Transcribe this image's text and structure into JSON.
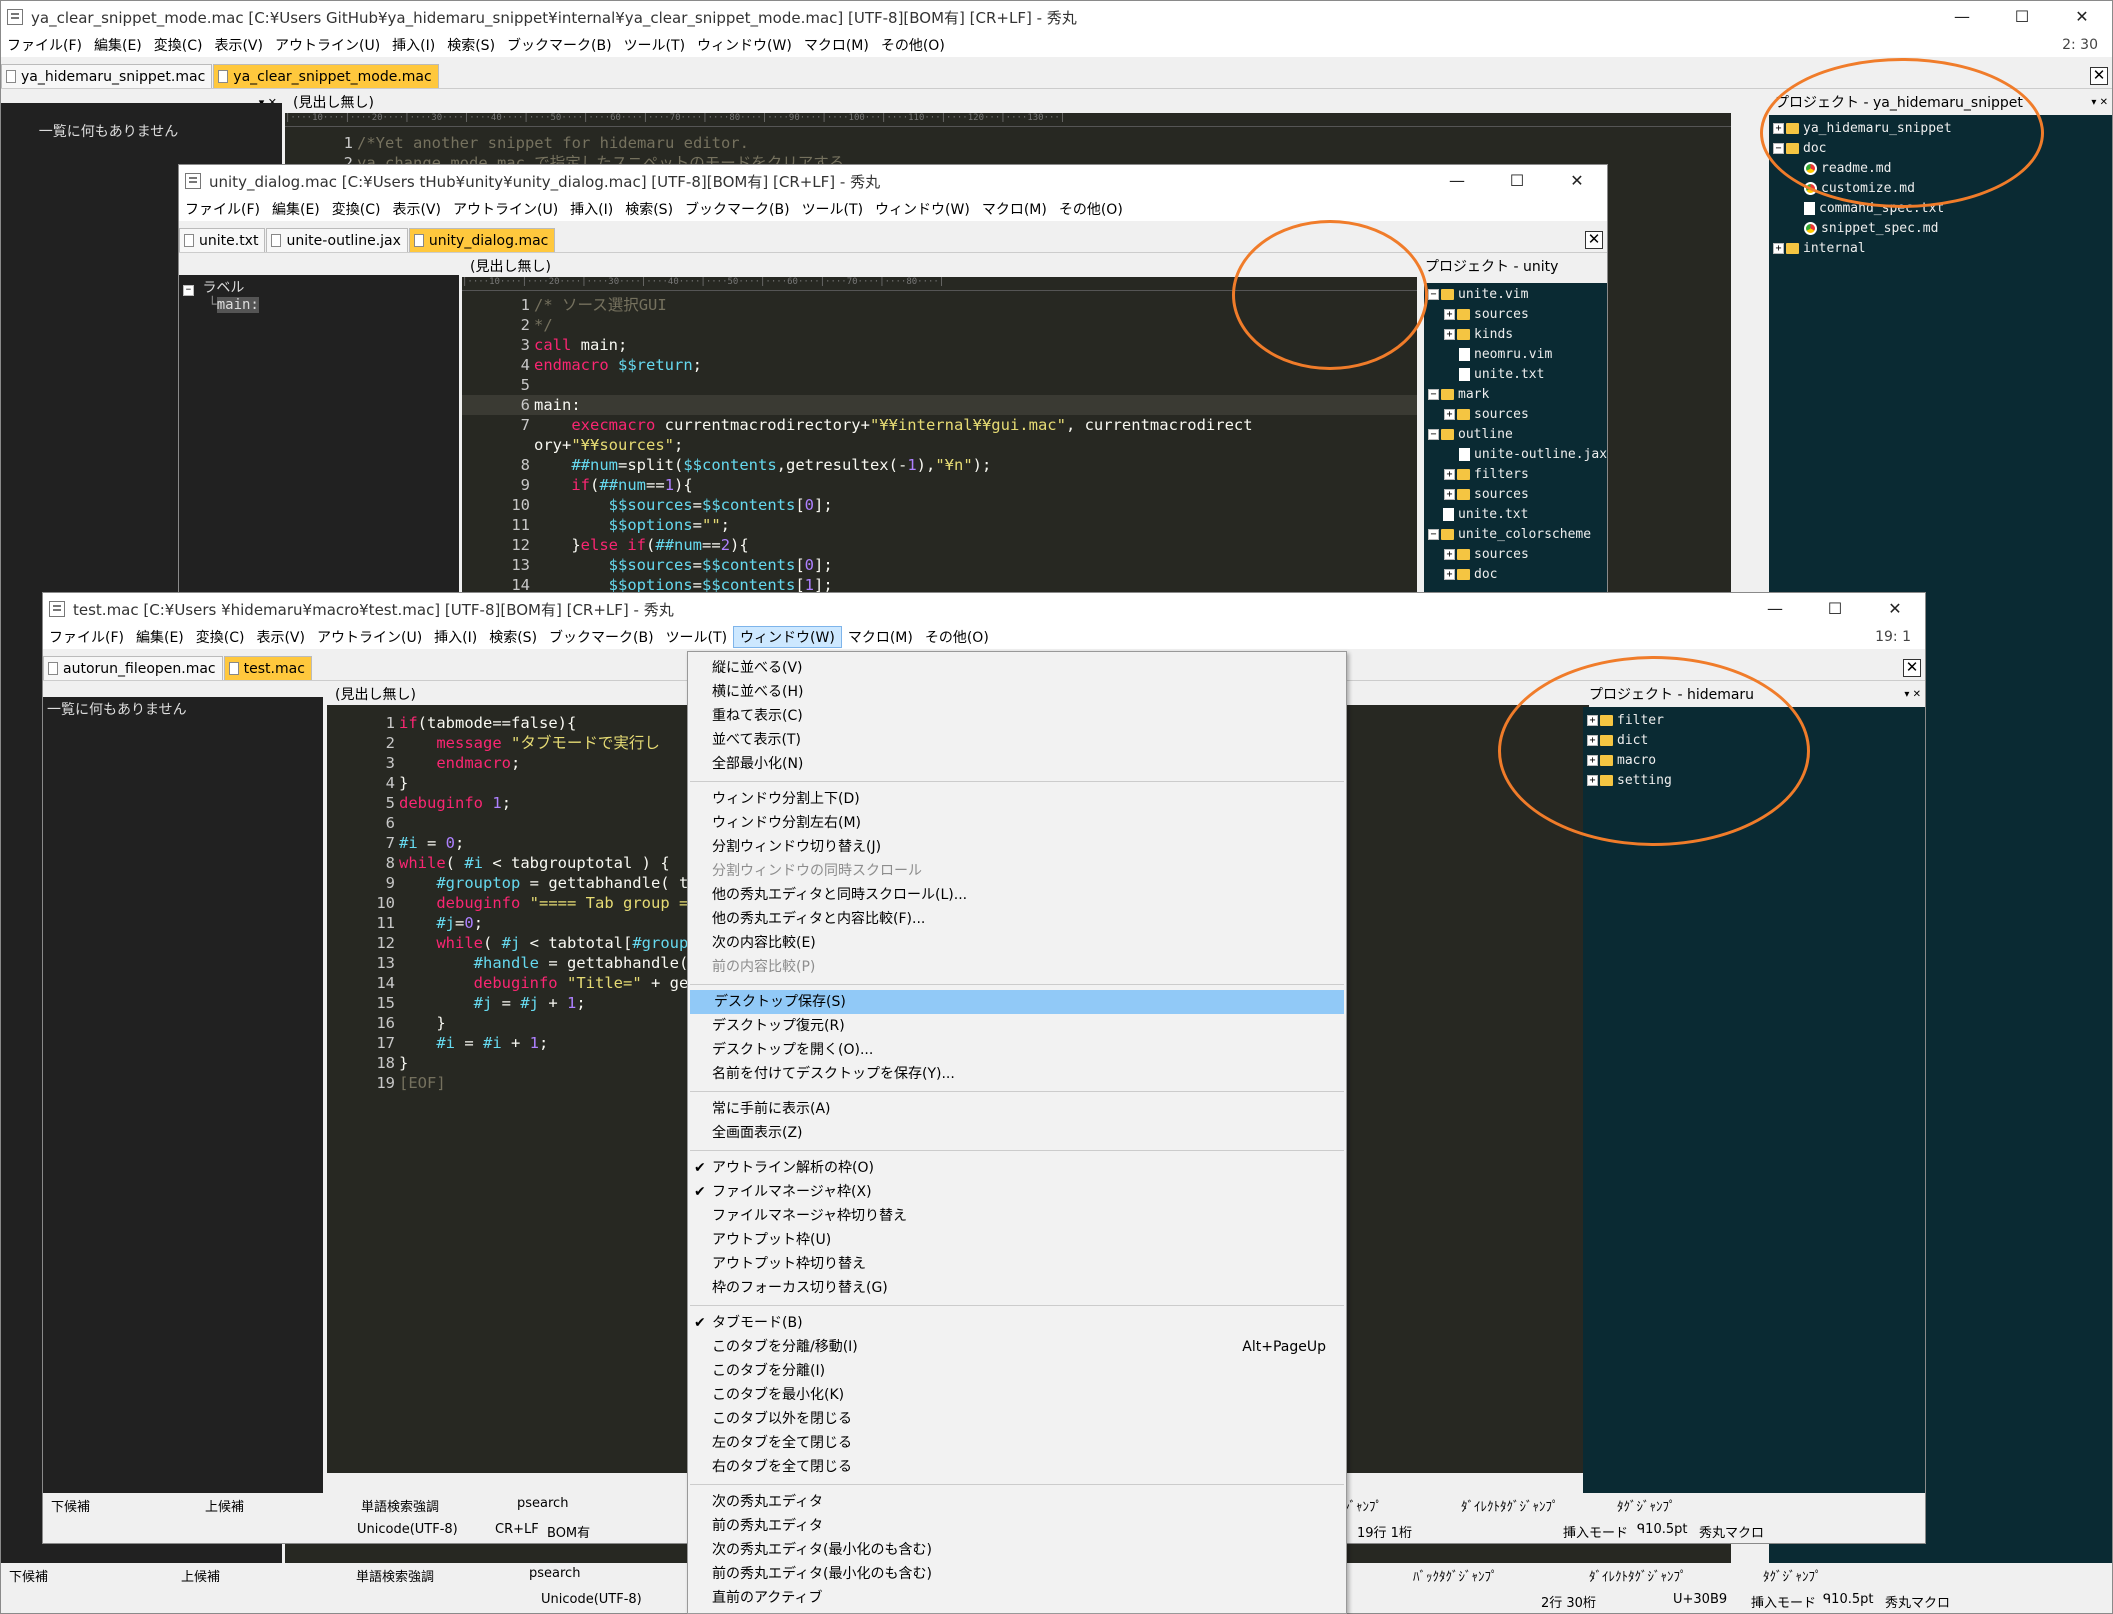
{
  "win1": {
    "title": "ya_clear_snippet_mode.mac [C:¥Users               GitHub¥ya_hidemaru_snippet¥internal¥ya_clear_snippet_mode.mac] [UTF-8][BOM有] [CR+LF] - 秀丸",
    "controls": [
      "—",
      "☐",
      "✕"
    ],
    "menus": [
      "ファイル(F)",
      "編集(E)",
      "変換(C)",
      "表示(V)",
      "アウトライン(U)",
      "挿入(I)",
      "検索(S)",
      "ブックマーク(B)",
      "ツール(T)",
      "ウィンドウ(W)",
      "マクロ(M)",
      "その他(O)"
    ],
    "cursor_pos": "2: 30",
    "tabs": [
      "ya_hidemaru_snippet.mac",
      "ya_clear_snippet_mode.mac"
    ],
    "outline_empty": "一覧に何もありません",
    "heading_none": "(見出し無し)",
    "code": [
      {
        "n": "1",
        "t": "/*Yet another snippet for hidemaru editor."
      },
      {
        "n": "2",
        "t": "ya_change_mode.mac で指定したスニペットのモードをクリアする。"
      }
    ],
    "project_title": "プロジェクト - ya_hidemaru_snippet",
    "project_tree": [
      {
        "label": "ya_hidemaru_snippet",
        "kind": "folder",
        "depth": 0
      },
      {
        "label": "doc",
        "kind": "folder",
        "depth": 0,
        "open": true
      },
      {
        "label": "readme.md",
        "kind": "chrome",
        "depth": 1
      },
      {
        "label": "customize.md",
        "kind": "chrome",
        "depth": 1
      },
      {
        "label": "command_spec.txt",
        "kind": "file",
        "depth": 1
      },
      {
        "label": "snippet_spec.md",
        "kind": "chrome",
        "depth": 1
      },
      {
        "label": "internal",
        "kind": "folder",
        "depth": 0
      }
    ],
    "status_left": [
      "下候補",
      "上候補",
      "単語検索強調",
      "psearch"
    ],
    "status_right": [
      "ﾊﾞｯｸﾀｸﾞｼﾞｬﾝﾌﾟ",
      "ﾀﾞｲﾚｸﾄﾀｸﾞｼﾞｬﾝﾌﾟ",
      "ﾀｸﾞｼﾞｬﾝﾌﾟ"
    ],
    "status2": [
      "Unicode(UTF-8)",
      "2行 30桁",
      "U+30B9",
      "挿入モード",
      "ᑫ10.5pt",
      "秀丸マクロ"
    ]
  },
  "win2": {
    "title": "unity_dialog.mac [C:¥Users               tHub¥unity¥unity_dialog.mac] [UTF-8][BOM有] [CR+LF] - 秀丸",
    "controls": [
      "—",
      "☐",
      "✕"
    ],
    "menus": [
      "ファイル(F)",
      "編集(E)",
      "変換(C)",
      "表示(V)",
      "アウトライン(U)",
      "挿入(I)",
      "検索(S)",
      "ブックマーク(B)",
      "ツール(T)",
      "ウィンドウ(W)",
      "マクロ(M)",
      "その他(O)"
    ],
    "tabs": [
      "unite.txt",
      "unite-outline.jax",
      "unity_dialog.mac"
    ],
    "outline_root": "ラベル",
    "outline_child": "main:",
    "heading_none": "(見出し無し)",
    "code": [
      {
        "n": "1",
        "t": "/* ソース選択GUI"
      },
      {
        "n": "2",
        "t": "*/"
      },
      {
        "n": "3",
        "t": "call main;"
      },
      {
        "n": "4",
        "t": "endmacro $$return;"
      },
      {
        "n": "5",
        "t": ""
      },
      {
        "n": "6",
        "t": "main:"
      },
      {
        "n": "7",
        "t": "    execmacro currentmacrodirectory+\"¥¥internal¥¥gui.mac\", currentmacrodirect"
      },
      {
        "n": "",
        "t": "ory+\"¥¥sources\";"
      },
      {
        "n": "8",
        "t": "    ##num=split($$contents,getresultex(-1),\"¥n\");"
      },
      {
        "n": "9",
        "t": "    if(##num==1){"
      },
      {
        "n": "10",
        "t": "        $$sources=$$contents[0];"
      },
      {
        "n": "11",
        "t": "        $$options=\"\";"
      },
      {
        "n": "12",
        "t": "    }else if(##num==2){"
      },
      {
        "n": "13",
        "t": "        $$sources=$$contents[0];"
      },
      {
        "n": "14",
        "t": "        $$options=$$contents[1];"
      }
    ],
    "project_title": "プロジェクト - unity",
    "project_tree": [
      {
        "label": "unite.vim",
        "kind": "folder",
        "depth": 0,
        "open": true
      },
      {
        "label": "sources",
        "kind": "folder",
        "depth": 1
      },
      {
        "label": "kinds",
        "kind": "folder",
        "depth": 1
      },
      {
        "label": "neomru.vim",
        "kind": "vim",
        "depth": 1
      },
      {
        "label": "unite.txt",
        "kind": "file",
        "depth": 1
      },
      {
        "label": "mark",
        "kind": "folder",
        "depth": 0,
        "open": true
      },
      {
        "label": "sources",
        "kind": "folder",
        "depth": 1
      },
      {
        "label": "outline",
        "kind": "folder",
        "depth": 0,
        "open": true
      },
      {
        "label": "unite-outline.jax",
        "kind": "file",
        "depth": 1
      },
      {
        "label": "filters",
        "kind": "folder",
        "depth": 1
      },
      {
        "label": "sources",
        "kind": "folder",
        "depth": 1
      },
      {
        "label": "unite.txt",
        "kind": "vim",
        "depth": 0
      },
      {
        "label": "unite_colorscheme",
        "kind": "folder",
        "depth": 0,
        "open": true
      },
      {
        "label": "sources",
        "kind": "folder",
        "depth": 1
      },
      {
        "label": "doc",
        "kind": "folder",
        "depth": 1
      }
    ]
  },
  "win3": {
    "title": "test.mac [C:¥Users               ¥hidemaru¥macro¥test.mac] [UTF-8][BOM有] [CR+LF] - 秀丸",
    "controls": [
      "—",
      "☐",
      "✕"
    ],
    "menus": [
      "ファイル(F)",
      "編集(E)",
      "変換(C)",
      "表示(V)",
      "アウトライン(U)",
      "挿入(I)",
      "検索(S)",
      "ブックマーク(B)",
      "ツール(T)",
      "ウィンドウ(W)",
      "マクロ(M)",
      "その他(O)"
    ],
    "cursor_pos": "19: 1",
    "tabs": [
      "autorun_fileopen.mac",
      "test.mac"
    ],
    "outline_empty": "一覧に何もありません",
    "heading_none": "(見出し無し)",
    "code": [
      {
        "n": "1",
        "t": "if(tabmode==false){"
      },
      {
        "n": "2",
        "t": "    message \"タブモードで実行し"
      },
      {
        "n": "3",
        "t": "    endmacro;"
      },
      {
        "n": "4",
        "t": "}"
      },
      {
        "n": "5",
        "t": "debuginfo 1;"
      },
      {
        "n": "6",
        "t": ""
      },
      {
        "n": "7",
        "t": "#i = 0;"
      },
      {
        "n": "8",
        "t": "while( #i < tabgrouptotal ) {"
      },
      {
        "n": "9",
        "t": "    #grouptop = gettabhandle( t"
      },
      {
        "n": "10",
        "t": "    debuginfo \"==== Tab group ="
      },
      {
        "n": "11",
        "t": "    #j=0;"
      },
      {
        "n": "12",
        "t": "    while( #j < tabtotal[#group"
      },
      {
        "n": "13",
        "t": "        #handle = gettabhandle("
      },
      {
        "n": "14",
        "t": "        debuginfo \"Title=\" + ge"
      },
      {
        "n": "15",
        "t": "        #j = #j + 1;"
      },
      {
        "n": "16",
        "t": "    }"
      },
      {
        "n": "17",
        "t": "    #i = #i + 1;"
      },
      {
        "n": "18",
        "t": "}"
      },
      {
        "n": "19",
        "t": "[EOF]"
      }
    ],
    "project_title": "プロジェクト - hidemaru",
    "project_tree": [
      {
        "label": "filter",
        "kind": "folder",
        "depth": 0
      },
      {
        "label": "dict",
        "kind": "folder",
        "depth": 0
      },
      {
        "label": "macro",
        "kind": "folder",
        "depth": 0
      },
      {
        "label": "setting",
        "kind": "folder",
        "depth": 0
      }
    ],
    "status_left": [
      "下候補",
      "上候補",
      "単語検索強調",
      "psearch"
    ],
    "status_right": [
      "ｼﾞｬﾝﾌﾟ",
      "ﾀﾞｲﾚｸﾄﾀｸﾞｼﾞｬﾝﾌﾟ",
      "ﾀｸﾞｼﾞｬﾝﾌﾟ"
    ],
    "status2": [
      "Unicode(UTF-8)",
      "CR+LF",
      "BOM有",
      "19行 1桁",
      "挿入モード",
      "ᑫ10.5pt",
      "秀丸マクロ"
    ]
  },
  "window_menu": {
    "items": [
      {
        "label": "縦に並べる(V)"
      },
      {
        "label": "横に並べる(H)"
      },
      {
        "label": "重ねて表示(C)"
      },
      {
        "label": "並べて表示(T)"
      },
      {
        "label": "全部最小化(N)"
      },
      {
        "sep": true
      },
      {
        "label": "ウィンドウ分割上下(D)"
      },
      {
        "label": "ウィンドウ分割左右(M)"
      },
      {
        "label": "分割ウィンドウ切り替え(J)"
      },
      {
        "label": "分割ウィンドウの同時スクロール",
        "disabled": true
      },
      {
        "label": "他の秀丸エディタと同時スクロール(L)..."
      },
      {
        "label": "他の秀丸エディタと内容比較(F)..."
      },
      {
        "label": "次の内容比較(E)"
      },
      {
        "label": "前の内容比較(P)",
        "disabled": true
      },
      {
        "sep": true
      },
      {
        "label": "デスクトップ保存(S)",
        "highlight": true
      },
      {
        "label": "デスクトップ復元(R)"
      },
      {
        "label": "デスクトップを開く(O)..."
      },
      {
        "label": "名前を付けてデスクトップを保存(Y)..."
      },
      {
        "sep": true
      },
      {
        "label": "常に手前に表示(A)"
      },
      {
        "label": "全画面表示(Z)"
      },
      {
        "sep": true
      },
      {
        "label": "アウトライン解析の枠(O)",
        "checked": true
      },
      {
        "label": "ファイルマネージャ枠(X)",
        "checked": true
      },
      {
        "label": "ファイルマネージャ枠切り替え"
      },
      {
        "label": "アウトプット枠(U)"
      },
      {
        "label": "アウトプット枠切り替え"
      },
      {
        "label": "枠のフォーカス切り替え(G)"
      },
      {
        "sep": true
      },
      {
        "label": "タブモード(B)",
        "checked": true
      },
      {
        "label": "このタブを分離/移動(I)",
        "shortcut": "Alt+PageUp"
      },
      {
        "label": "このタブを分離(I)"
      },
      {
        "label": "このタブを最小化(K)"
      },
      {
        "label": "このタブ以外を閉じる"
      },
      {
        "label": "左のタブを全て閉じる"
      },
      {
        "label": "右のタブを全て閉じる"
      },
      {
        "sep": true
      },
      {
        "label": "次の秀丸エディタ"
      },
      {
        "label": "前の秀丸エディタ"
      },
      {
        "label": "次の秀丸エディタ(最小化のも含む)"
      },
      {
        "label": "前の秀丸エディタ(最小化のも含む)"
      },
      {
        "label": "直前のアクティブ"
      }
    ]
  },
  "colors": {
    "highlight_ring": "#f07c2a",
    "active_tab": "#ffc83d",
    "menu_highlight": "#91c9f7",
    "editor_bg": "#272822",
    "project_bg": "#0a2a33"
  }
}
